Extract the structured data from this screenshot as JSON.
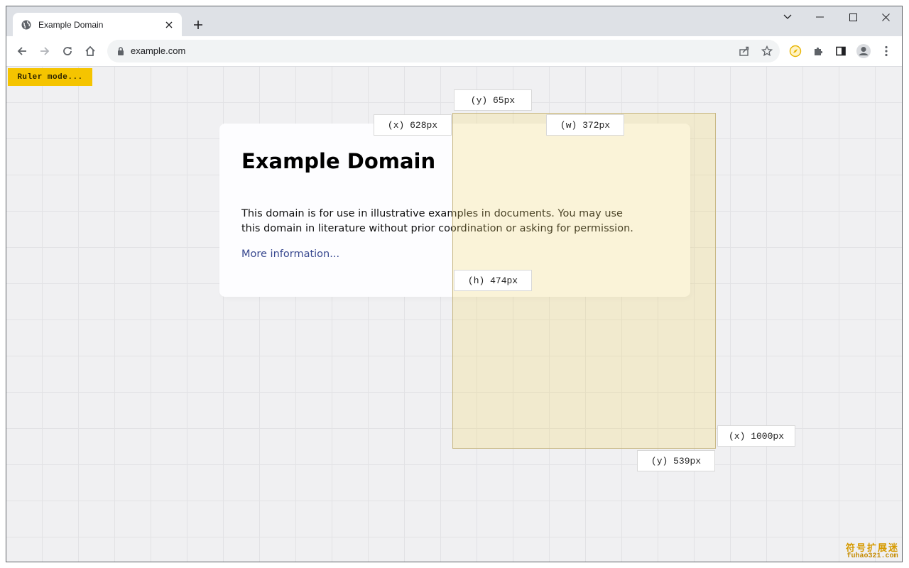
{
  "browser": {
    "tab": {
      "title": "Example Domain",
      "favicon": "globe-icon",
      "close_icon": "close-icon"
    },
    "new_tab_icon": "plus-icon",
    "window_controls": [
      "tab-search-icon",
      "minimize-icon",
      "maximize-icon",
      "close-icon"
    ],
    "toolbar": {
      "back_icon": "arrow-left-icon",
      "forward_icon": "arrow-right-icon",
      "reload_icon": "reload-icon",
      "home_icon": "home-icon",
      "url": "example.com",
      "lock_icon": "lock-icon",
      "omnibox_actions": [
        "share-icon",
        "star-icon"
      ],
      "extensions": [
        "compass-extension-icon",
        "puzzle-icon",
        "side-panel-icon",
        "profile-icon",
        "menu-dots-icon"
      ]
    }
  },
  "page": {
    "ruler_button": "Ruler mode...",
    "card": {
      "heading": "Example Domain",
      "paragraph": "This domain is for use in illustrative examples in documents. You may use this domain in literature without prior coordination or asking for permission.",
      "link": "More information..."
    },
    "measure_labels": {
      "top_y": "(y) 65px",
      "left_x": "(x) 628px",
      "width": "(w) 372px",
      "height": "(h) 474px",
      "right_x": "(x) 1000px",
      "bottom_y": "(y) 539px"
    },
    "watermark": {
      "main": "符号扩展迷",
      "sub": "fuhao321.com"
    }
  },
  "colors": {
    "accent_yellow": "#f5c400",
    "link": "#38488f",
    "background": "#f0f0f2",
    "measure_fill": "#f2d664"
  }
}
